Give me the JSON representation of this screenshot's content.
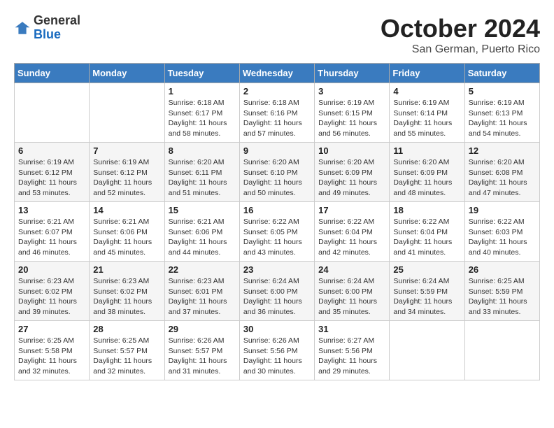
{
  "logo": {
    "general": "General",
    "blue": "Blue"
  },
  "header": {
    "month": "October 2024",
    "location": "San German, Puerto Rico"
  },
  "weekdays": [
    "Sunday",
    "Monday",
    "Tuesday",
    "Wednesday",
    "Thursday",
    "Friday",
    "Saturday"
  ],
  "weeks": [
    [
      {
        "day": "",
        "info": ""
      },
      {
        "day": "",
        "info": ""
      },
      {
        "day": "1",
        "info": "Sunrise: 6:18 AM\nSunset: 6:17 PM\nDaylight: 11 hours and 58 minutes."
      },
      {
        "day": "2",
        "info": "Sunrise: 6:18 AM\nSunset: 6:16 PM\nDaylight: 11 hours and 57 minutes."
      },
      {
        "day": "3",
        "info": "Sunrise: 6:19 AM\nSunset: 6:15 PM\nDaylight: 11 hours and 56 minutes."
      },
      {
        "day": "4",
        "info": "Sunrise: 6:19 AM\nSunset: 6:14 PM\nDaylight: 11 hours and 55 minutes."
      },
      {
        "day": "5",
        "info": "Sunrise: 6:19 AM\nSunset: 6:13 PM\nDaylight: 11 hours and 54 minutes."
      }
    ],
    [
      {
        "day": "6",
        "info": "Sunrise: 6:19 AM\nSunset: 6:12 PM\nDaylight: 11 hours and 53 minutes."
      },
      {
        "day": "7",
        "info": "Sunrise: 6:19 AM\nSunset: 6:12 PM\nDaylight: 11 hours and 52 minutes."
      },
      {
        "day": "8",
        "info": "Sunrise: 6:20 AM\nSunset: 6:11 PM\nDaylight: 11 hours and 51 minutes."
      },
      {
        "day": "9",
        "info": "Sunrise: 6:20 AM\nSunset: 6:10 PM\nDaylight: 11 hours and 50 minutes."
      },
      {
        "day": "10",
        "info": "Sunrise: 6:20 AM\nSunset: 6:09 PM\nDaylight: 11 hours and 49 minutes."
      },
      {
        "day": "11",
        "info": "Sunrise: 6:20 AM\nSunset: 6:09 PM\nDaylight: 11 hours and 48 minutes."
      },
      {
        "day": "12",
        "info": "Sunrise: 6:20 AM\nSunset: 6:08 PM\nDaylight: 11 hours and 47 minutes."
      }
    ],
    [
      {
        "day": "13",
        "info": "Sunrise: 6:21 AM\nSunset: 6:07 PM\nDaylight: 11 hours and 46 minutes."
      },
      {
        "day": "14",
        "info": "Sunrise: 6:21 AM\nSunset: 6:06 PM\nDaylight: 11 hours and 45 minutes."
      },
      {
        "day": "15",
        "info": "Sunrise: 6:21 AM\nSunset: 6:06 PM\nDaylight: 11 hours and 44 minutes."
      },
      {
        "day": "16",
        "info": "Sunrise: 6:22 AM\nSunset: 6:05 PM\nDaylight: 11 hours and 43 minutes."
      },
      {
        "day": "17",
        "info": "Sunrise: 6:22 AM\nSunset: 6:04 PM\nDaylight: 11 hours and 42 minutes."
      },
      {
        "day": "18",
        "info": "Sunrise: 6:22 AM\nSunset: 6:04 PM\nDaylight: 11 hours and 41 minutes."
      },
      {
        "day": "19",
        "info": "Sunrise: 6:22 AM\nSunset: 6:03 PM\nDaylight: 11 hours and 40 minutes."
      }
    ],
    [
      {
        "day": "20",
        "info": "Sunrise: 6:23 AM\nSunset: 6:02 PM\nDaylight: 11 hours and 39 minutes."
      },
      {
        "day": "21",
        "info": "Sunrise: 6:23 AM\nSunset: 6:02 PM\nDaylight: 11 hours and 38 minutes."
      },
      {
        "day": "22",
        "info": "Sunrise: 6:23 AM\nSunset: 6:01 PM\nDaylight: 11 hours and 37 minutes."
      },
      {
        "day": "23",
        "info": "Sunrise: 6:24 AM\nSunset: 6:00 PM\nDaylight: 11 hours and 36 minutes."
      },
      {
        "day": "24",
        "info": "Sunrise: 6:24 AM\nSunset: 6:00 PM\nDaylight: 11 hours and 35 minutes."
      },
      {
        "day": "25",
        "info": "Sunrise: 6:24 AM\nSunset: 5:59 PM\nDaylight: 11 hours and 34 minutes."
      },
      {
        "day": "26",
        "info": "Sunrise: 6:25 AM\nSunset: 5:59 PM\nDaylight: 11 hours and 33 minutes."
      }
    ],
    [
      {
        "day": "27",
        "info": "Sunrise: 6:25 AM\nSunset: 5:58 PM\nDaylight: 11 hours and 32 minutes."
      },
      {
        "day": "28",
        "info": "Sunrise: 6:25 AM\nSunset: 5:57 PM\nDaylight: 11 hours and 32 minutes."
      },
      {
        "day": "29",
        "info": "Sunrise: 6:26 AM\nSunset: 5:57 PM\nDaylight: 11 hours and 31 minutes."
      },
      {
        "day": "30",
        "info": "Sunrise: 6:26 AM\nSunset: 5:56 PM\nDaylight: 11 hours and 30 minutes."
      },
      {
        "day": "31",
        "info": "Sunrise: 6:27 AM\nSunset: 5:56 PM\nDaylight: 11 hours and 29 minutes."
      },
      {
        "day": "",
        "info": ""
      },
      {
        "day": "",
        "info": ""
      }
    ]
  ]
}
